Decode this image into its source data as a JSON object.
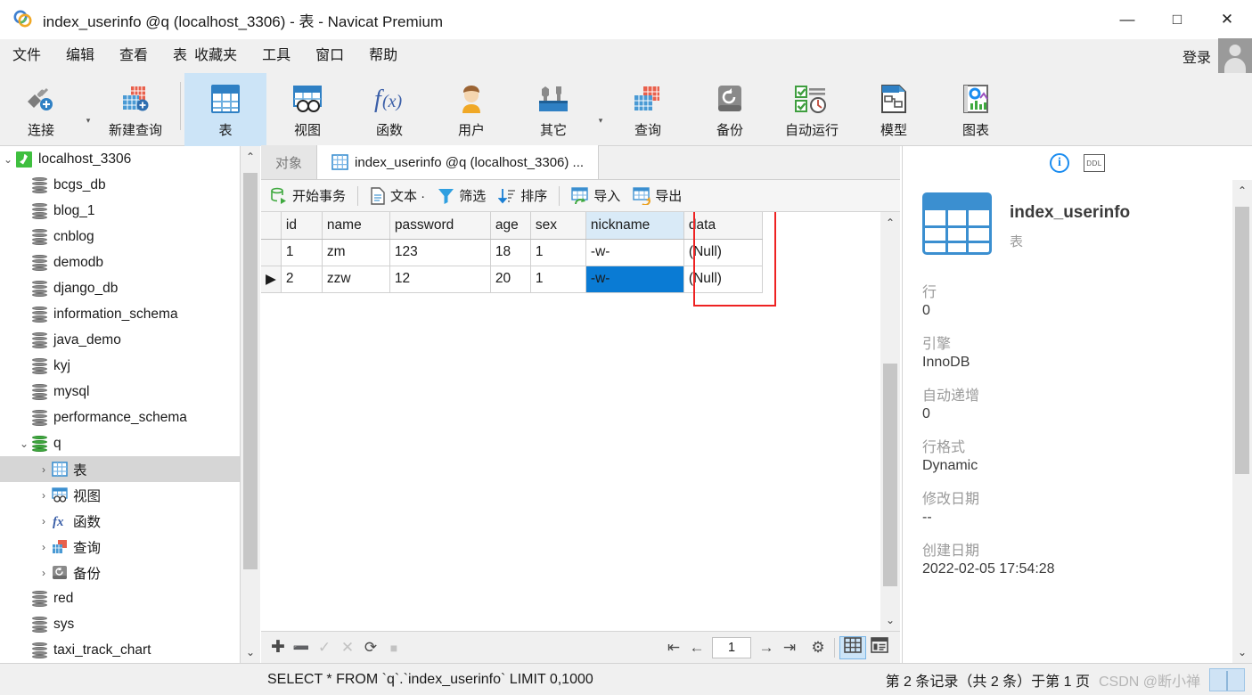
{
  "window": {
    "title": "index_userinfo @q (localhost_3306) - 表 - Navicat Premium",
    "minimize": "—",
    "maximize": "□",
    "close": "✕"
  },
  "menubar": {
    "items": [
      {
        "label": "文件"
      },
      {
        "label": "编辑"
      },
      {
        "label": "查看"
      },
      {
        "label": "表"
      },
      {
        "label": "收藏夹"
      },
      {
        "label": "工具"
      },
      {
        "label": "窗口"
      },
      {
        "label": "帮助"
      }
    ],
    "login_label": "登录",
    "avatar_icon": "user-avatar-icon"
  },
  "toolbar": {
    "items": [
      {
        "label": "连接",
        "icon": "connection-plug-icon",
        "active": false
      },
      {
        "label": "新建查询",
        "icon": "new-query-icon",
        "active": false
      },
      {
        "label": "表",
        "icon": "table-icon",
        "active": true
      },
      {
        "label": "视图",
        "icon": "view-icon",
        "active": false
      },
      {
        "label": "函数",
        "icon": "function-fx-icon",
        "active": false
      },
      {
        "label": "用户",
        "icon": "user-icon",
        "active": false
      },
      {
        "label": "其它",
        "icon": "other-tools-icon",
        "active": false
      },
      {
        "label": "查询",
        "icon": "query-icon",
        "active": false
      },
      {
        "label": "备份",
        "icon": "backup-icon",
        "active": false
      },
      {
        "label": "自动运行",
        "icon": "automation-icon",
        "active": false
      },
      {
        "label": "模型",
        "icon": "model-icon",
        "active": false
      },
      {
        "label": "图表",
        "icon": "chart-icon",
        "active": false
      }
    ]
  },
  "sidebar": {
    "tree": [
      {
        "label": "localhost_3306",
        "icon": "server-icon",
        "indent": 0,
        "twisty": "⌄",
        "selected": false
      },
      {
        "label": "bcgs_db",
        "icon": "database-icon",
        "indent": 1,
        "twisty": "",
        "selected": false
      },
      {
        "label": "blog_1",
        "icon": "database-icon",
        "indent": 1,
        "twisty": "",
        "selected": false
      },
      {
        "label": "cnblog",
        "icon": "database-icon",
        "indent": 1,
        "twisty": "",
        "selected": false
      },
      {
        "label": "demodb",
        "icon": "database-icon",
        "indent": 1,
        "twisty": "",
        "selected": false
      },
      {
        "label": "django_db",
        "icon": "database-icon",
        "indent": 1,
        "twisty": "",
        "selected": false
      },
      {
        "label": "information_schema",
        "icon": "database-icon",
        "indent": 1,
        "twisty": "",
        "selected": false
      },
      {
        "label": "java_demo",
        "icon": "database-icon",
        "indent": 1,
        "twisty": "",
        "selected": false
      },
      {
        "label": "kyj",
        "icon": "database-icon",
        "indent": 1,
        "twisty": "",
        "selected": false
      },
      {
        "label": "mysql",
        "icon": "database-icon",
        "indent": 1,
        "twisty": "",
        "selected": false
      },
      {
        "label": "performance_schema",
        "icon": "database-icon",
        "indent": 1,
        "twisty": "",
        "selected": false
      },
      {
        "label": "q",
        "icon": "database-open-icon",
        "indent": 1,
        "twisty": "⌄",
        "selected": false
      },
      {
        "label": "表",
        "icon": "tables-folder-icon",
        "indent": 2,
        "twisty": "›",
        "selected": true
      },
      {
        "label": "视图",
        "icon": "views-folder-icon",
        "indent": 2,
        "twisty": "›",
        "selected": false
      },
      {
        "label": "函数",
        "icon": "functions-folder-icon",
        "indent": 2,
        "twisty": "›",
        "selected": false
      },
      {
        "label": "查询",
        "icon": "queries-folder-icon",
        "indent": 2,
        "twisty": "›",
        "selected": false
      },
      {
        "label": "备份",
        "icon": "backups-folder-icon",
        "indent": 2,
        "twisty": "›",
        "selected": false
      },
      {
        "label": "red",
        "icon": "database-icon",
        "indent": 1,
        "twisty": "",
        "selected": false
      },
      {
        "label": "sys",
        "icon": "database-icon",
        "indent": 1,
        "twisty": "",
        "selected": false
      },
      {
        "label": "taxi_track_chart",
        "icon": "database-icon",
        "indent": 1,
        "twisty": "",
        "selected": false
      }
    ]
  },
  "tabs": [
    {
      "label": "对象",
      "icon": "",
      "active": false
    },
    {
      "label": "index_userinfo @q (localhost_3306) ...",
      "icon": "table-icon",
      "active": true
    }
  ],
  "grid_toolbar": {
    "items": [
      {
        "label": "开始事务",
        "icon": "begin-transaction-icon"
      },
      {
        "label": "文本 ·",
        "icon": "text-icon"
      },
      {
        "label": "筛选",
        "icon": "filter-icon"
      },
      {
        "label": "排序",
        "icon": "sort-icon"
      },
      {
        "label": "导入",
        "icon": "import-icon"
      },
      {
        "label": "导出",
        "icon": "export-icon"
      }
    ]
  },
  "table": {
    "columns": [
      "id",
      "name",
      "password",
      "age",
      "sex",
      "nickname",
      "data"
    ],
    "highlighted_column": "nickname",
    "rows": [
      {
        "marker": "",
        "id": "1",
        "name": "zm",
        "password": "123",
        "age": "18",
        "sex": "1",
        "nickname": "-w-",
        "data": "(Null)",
        "selected_cell": ""
      },
      {
        "marker": "▶",
        "id": "2",
        "name": "zzw",
        "password": "12",
        "age": "20",
        "sex": "1",
        "nickname": "-w-",
        "data": "(Null)",
        "selected_cell": "nickname"
      }
    ],
    "annotation": {
      "color": "#ee2222",
      "target_column": "data"
    }
  },
  "navbar": {
    "buttons": [
      {
        "icon": "add-record-icon",
        "glyph": "✚",
        "state": "dark"
      },
      {
        "icon": "remove-record-icon",
        "glyph": "➖",
        "state": "dark"
      },
      {
        "icon": "apply-changes-icon",
        "glyph": "✓",
        "state": "dim"
      },
      {
        "icon": "cancel-changes-icon",
        "glyph": "✕",
        "state": "dim"
      },
      {
        "icon": "refresh-icon",
        "glyph": "⟳",
        "state": "dark"
      },
      {
        "icon": "stop-icon",
        "glyph": "■",
        "state": "dim"
      }
    ],
    "pager": [
      {
        "icon": "first-page-icon",
        "glyph": "⇤"
      },
      {
        "icon": "prev-page-icon",
        "glyph": "←"
      }
    ],
    "page_value": "1",
    "pager_after": [
      {
        "icon": "next-page-icon",
        "glyph": "→"
      },
      {
        "icon": "last-page-icon",
        "glyph": "⇥"
      },
      {
        "icon": "gear-icon",
        "glyph": "⚙"
      }
    ],
    "views": [
      {
        "icon": "grid-view-icon",
        "active": true
      },
      {
        "icon": "form-view-icon",
        "active": false
      }
    ]
  },
  "info_panel": {
    "icons": [
      {
        "icon": "info-circle-icon",
        "glyph": "i"
      },
      {
        "icon": "ddl-icon",
        "glyph": "DDL"
      }
    ],
    "object_icon": "table-icon",
    "object_name": "index_userinfo",
    "object_type": "表",
    "fields": [
      {
        "label": "行",
        "value": "0"
      },
      {
        "label": "引擎",
        "value": "InnoDB"
      },
      {
        "label": "自动递增",
        "value": "0"
      },
      {
        "label": "行格式",
        "value": "Dynamic"
      },
      {
        "label": "修改日期",
        "value": "--"
      },
      {
        "label": "创建日期",
        "value": "2022-02-05 17:54:28"
      }
    ]
  },
  "statusbar": {
    "sql": "SELECT * FROM `q`.`index_userinfo` LIMIT 0,1000",
    "record_info": "第 2 条记录（共 2 条）于第 1 页",
    "watermark": "CSDN @断小禅"
  },
  "colors": {
    "accent": "#0a7bd4",
    "toolbar_active": "#cce4f7",
    "annotation_red": "#ee2222",
    "header_highlight": "#d9eaf7"
  }
}
